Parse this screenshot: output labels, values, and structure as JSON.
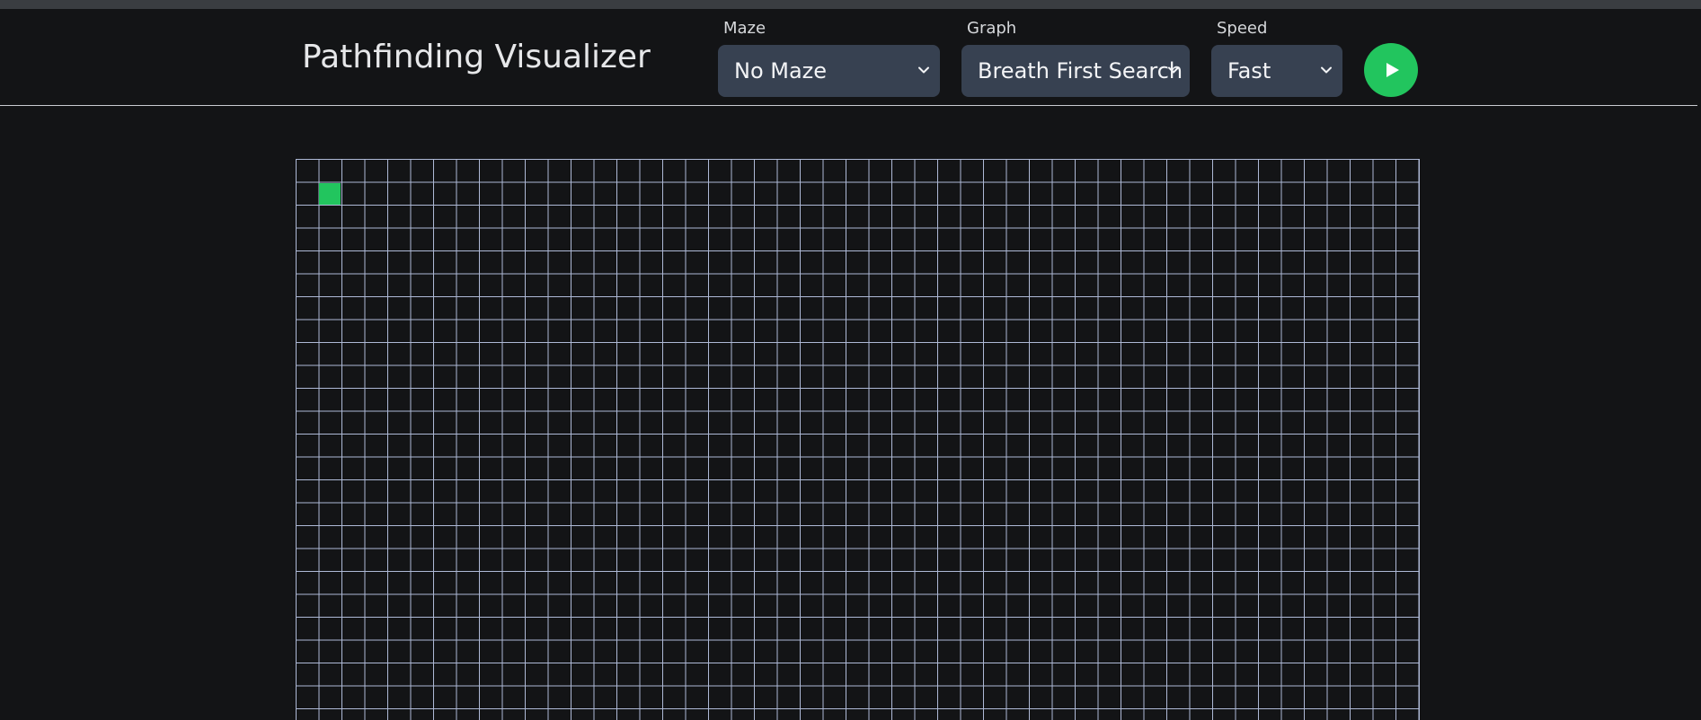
{
  "header": {
    "title": "Pathfinding Visualizer"
  },
  "controls": {
    "maze": {
      "label": "Maze",
      "selected": "No Maze"
    },
    "graph": {
      "label": "Graph",
      "selected": "Breath First Search"
    },
    "speed": {
      "label": "Speed",
      "selected": "Fast"
    },
    "run_button_icon": "play-icon"
  },
  "grid": {
    "start_node_color": "#22c55e",
    "line_color": "#aeb9d6"
  },
  "colors": {
    "background": "#131416",
    "select_bg": "#374151",
    "accent": "#22c55e"
  }
}
